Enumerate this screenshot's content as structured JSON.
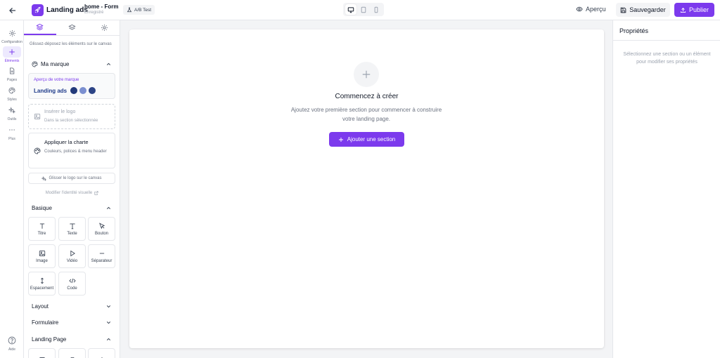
{
  "topbar": {
    "app_title": "Landing ads",
    "page_name": "home - Form",
    "page_status": "Enregistré",
    "ab_test": "A/B Test",
    "preview": "Aperçu",
    "save": "Sauvegarder",
    "publish": "Publier",
    "active_device": "desktop"
  },
  "rail": {
    "items": [
      {
        "label": "Configuration",
        "icon": "gear-icon"
      },
      {
        "label": "Éléments",
        "icon": "plus-icon",
        "active": true
      },
      {
        "label": "Pages",
        "icon": "file-icon"
      },
      {
        "label": "Styles",
        "icon": "palette-icon"
      },
      {
        "label": "Outils",
        "icon": "sparkles-icon"
      },
      {
        "label": "Plus",
        "icon": "more-icon"
      }
    ],
    "bottom": {
      "label": "Aide",
      "icon": "help-icon"
    }
  },
  "panel": {
    "hint": "Glissez-déposez les éléments sur le canvas",
    "brand": {
      "title": "Ma marque",
      "preview_label": "Aperçu de votre marque",
      "brand_name": "Landing ads",
      "colors": [
        "#233a7a",
        "#7b8fd0",
        "#2d4486"
      ],
      "insert_logo": "Insérer le logo",
      "insert_logo_sub": "Dans la section sélectionnée",
      "apply_charte": "Appliquer la charte",
      "apply_charte_sub": "Couleurs, polices & menu header",
      "drag_logo": "Glisser le logo sur le canvas",
      "modify_identity": "Modifier l'identité visuelle"
    },
    "basic": {
      "title": "Basique",
      "items": [
        {
          "label": "Titre",
          "icon": "heading-icon"
        },
        {
          "label": "Texte",
          "icon": "text-icon"
        },
        {
          "label": "Bouton",
          "icon": "cursor-icon"
        },
        {
          "label": "Image",
          "icon": "image-icon"
        },
        {
          "label": "Vidéo",
          "icon": "play-icon"
        },
        {
          "label": "Séparateur",
          "icon": "minus-icon"
        },
        {
          "label": "Espacement",
          "icon": "vertical-arrows-icon"
        },
        {
          "label": "Code",
          "icon": "code-icon"
        }
      ]
    },
    "layout": {
      "title": "Layout"
    },
    "form": {
      "title": "Formulaire"
    },
    "landing": {
      "title": "Landing Page"
    }
  },
  "canvas": {
    "empty_title": "Commencez à créer",
    "empty_desc": "Ajoutez votre première section pour commencer à construire votre landing page.",
    "add_section": "Ajouter une section"
  },
  "props": {
    "title": "Propriétés",
    "empty": "Sélectionnez une section ou un élément pour modifier ses propriétés"
  }
}
